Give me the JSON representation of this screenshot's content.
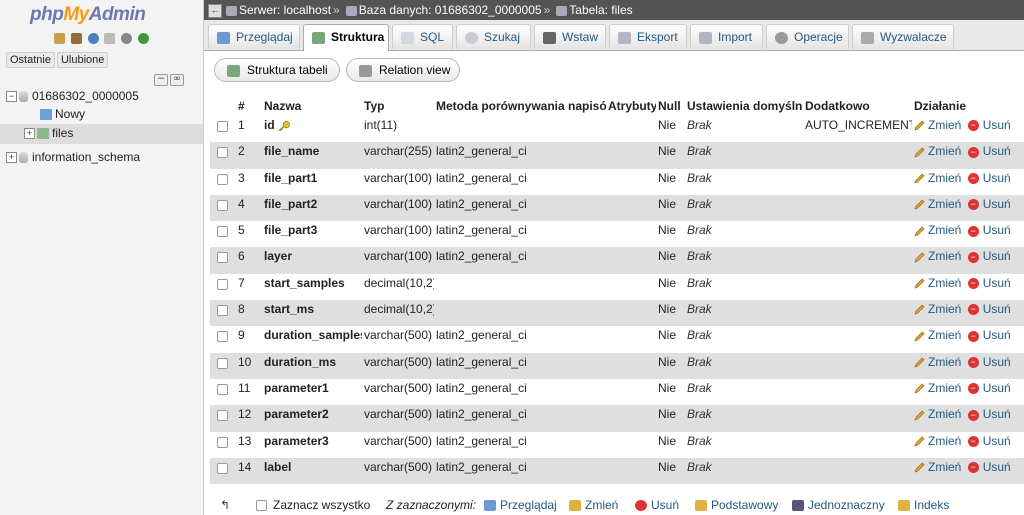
{
  "nav": {
    "logo_php": "php",
    "logo_my": "My",
    "logo_admin": "Admin",
    "tabs": [
      "Ostatnie",
      "Ulubione"
    ],
    "tree": {
      "db1": "01686302_0000005",
      "new_item": "Nowy",
      "table_item": "files",
      "db2": "information_schema"
    }
  },
  "breadcrumb": {
    "server": "Serwer: localhost",
    "database": "Baza danych: 01686302_0000005",
    "table": "Tabela: files"
  },
  "tabs": [
    "Przeglądaj",
    "Struktura",
    "SQL",
    "Szukaj",
    "Wstaw",
    "Eksport",
    "Import",
    "Operacje",
    "Wyzwalacze"
  ],
  "active_tab": "Struktura",
  "subnav": {
    "structure": "Struktura tabeli",
    "relation": "Relation view"
  },
  "columns": [
    "#",
    "Nazwa",
    "Typ",
    "Metoda porównywania napisów",
    "Atrybuty",
    "Null",
    "Ustawienia domyślne",
    "Dodatkowo",
    "Działanie"
  ],
  "actions": {
    "edit": "Zmień",
    "drop": "Usuń"
  },
  "rows": [
    {
      "num": "1",
      "name": "id",
      "type": "int(11)",
      "collation": "",
      "attr": "",
      "null": "Nie",
      "default": "Brak",
      "extra": "AUTO_INCREMENT",
      "primary": true
    },
    {
      "num": "2",
      "name": "file_name",
      "type": "varchar(255)",
      "collation": "latin2_general_ci",
      "attr": "",
      "null": "Nie",
      "default": "Brak",
      "extra": ""
    },
    {
      "num": "3",
      "name": "file_part1",
      "type": "varchar(100)",
      "collation": "latin2_general_ci",
      "attr": "",
      "null": "Nie",
      "default": "Brak",
      "extra": ""
    },
    {
      "num": "4",
      "name": "file_part2",
      "type": "varchar(100)",
      "collation": "latin2_general_ci",
      "attr": "",
      "null": "Nie",
      "default": "Brak",
      "extra": ""
    },
    {
      "num": "5",
      "name": "file_part3",
      "type": "varchar(100)",
      "collation": "latin2_general_ci",
      "attr": "",
      "null": "Nie",
      "default": "Brak",
      "extra": ""
    },
    {
      "num": "6",
      "name": "layer",
      "type": "varchar(100)",
      "collation": "latin2_general_ci",
      "attr": "",
      "null": "Nie",
      "default": "Brak",
      "extra": ""
    },
    {
      "num": "7",
      "name": "start_samples",
      "type": "decimal(10,2)",
      "collation": "",
      "attr": "",
      "null": "Nie",
      "default": "Brak",
      "extra": ""
    },
    {
      "num": "8",
      "name": "start_ms",
      "type": "decimal(10,2)",
      "collation": "",
      "attr": "",
      "null": "Nie",
      "default": "Brak",
      "extra": ""
    },
    {
      "num": "9",
      "name": "duration_samples",
      "type": "varchar(500)",
      "collation": "latin2_general_ci",
      "attr": "",
      "null": "Nie",
      "default": "Brak",
      "extra": ""
    },
    {
      "num": "10",
      "name": "duration_ms",
      "type": "varchar(500)",
      "collation": "latin2_general_ci",
      "attr": "",
      "null": "Nie",
      "default": "Brak",
      "extra": ""
    },
    {
      "num": "11",
      "name": "parameter1",
      "type": "varchar(500)",
      "collation": "latin2_general_ci",
      "attr": "",
      "null": "Nie",
      "default": "Brak",
      "extra": ""
    },
    {
      "num": "12",
      "name": "parameter2",
      "type": "varchar(500)",
      "collation": "latin2_general_ci",
      "attr": "",
      "null": "Nie",
      "default": "Brak",
      "extra": ""
    },
    {
      "num": "13",
      "name": "parameter3",
      "type": "varchar(500)",
      "collation": "latin2_general_ci",
      "attr": "",
      "null": "Nie",
      "default": "Brak",
      "extra": ""
    },
    {
      "num": "14",
      "name": "label",
      "type": "varchar(500)",
      "collation": "latin2_general_ci",
      "attr": "",
      "null": "Nie",
      "default": "Brak",
      "extra": ""
    }
  ],
  "footer": {
    "check_all": "Zaznacz wszystko",
    "with_selected": "Z zaznaczonymi:",
    "browse": "Przeglądaj",
    "edit": "Zmień",
    "drop": "Usuń",
    "primary": "Podstawowy",
    "unique": "Jednoznaczny",
    "index": "Indeks"
  },
  "colors": {
    "accent": "#235a81",
    "topbar": "#545454",
    "row_alt": "#dfdfdf",
    "logo_php": "#6c78af",
    "logo_my": "#f89c0e"
  }
}
